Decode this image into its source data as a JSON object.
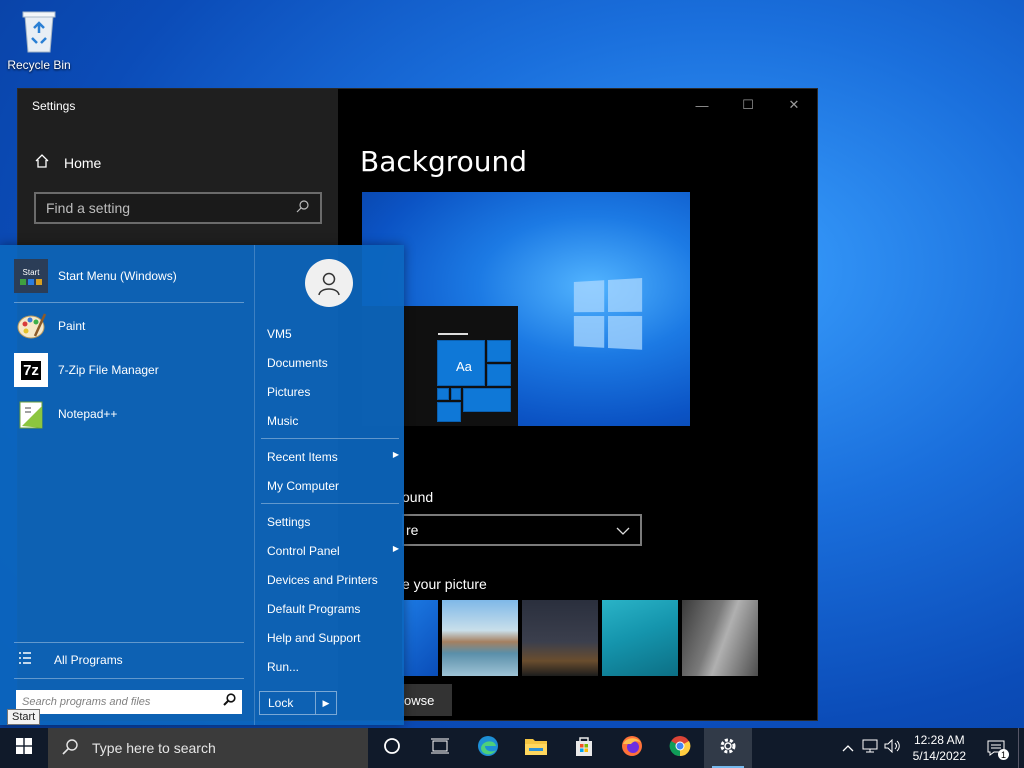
{
  "desktop": {
    "recycle_bin_label": "Recycle Bin"
  },
  "settings_window": {
    "title": "Settings",
    "home_label": "Home",
    "search_placeholder": "Find a setting",
    "page_title": "Background",
    "background_label": "ound",
    "background_value": "re",
    "choose_picture_label": "e your picture",
    "browse_label": "owse",
    "preview_tile_text": "Aa"
  },
  "start_menu": {
    "programs": [
      {
        "label": "Start Menu (Windows)",
        "icon": "start-menu-icon"
      },
      {
        "label": "Paint",
        "icon": "paint-icon"
      },
      {
        "label": "7-Zip File Manager",
        "icon": "7zip-icon"
      },
      {
        "label": "Notepad++",
        "icon": "notepadpp-icon"
      }
    ],
    "start_icon_text": "Start",
    "zip_icon_text": "7z",
    "all_programs_label": "All Programs",
    "search_placeholder": "Search programs and files",
    "user_name": "VM5",
    "right_items": [
      {
        "label": "Documents"
      },
      {
        "label": "Pictures"
      },
      {
        "label": "Music"
      },
      {
        "label": "Recent Items",
        "arrow": "▶"
      },
      {
        "label": "My Computer"
      },
      {
        "label": "Settings"
      },
      {
        "label": "Control Panel",
        "arrow": "▶"
      },
      {
        "label": "Devices and Printers"
      },
      {
        "label": "Default Programs"
      },
      {
        "label": "Help and Support"
      },
      {
        "label": "Run..."
      }
    ],
    "lock_label": "Lock",
    "lock_arrow": "▶"
  },
  "tooltip": "Start",
  "taskbar": {
    "search_placeholder": "Type here to search",
    "apps": [
      "cortana-icon",
      "task-view-icon",
      "edge-icon",
      "file-explorer-icon",
      "store-icon",
      "firefox-icon",
      "chrome-icon",
      "settings-gear-icon"
    ],
    "time": "12:28 AM",
    "date": "5/14/2022",
    "notification_count": "1"
  },
  "colors": {
    "accent": "#0c66be",
    "taskbar": "#101a2a"
  }
}
